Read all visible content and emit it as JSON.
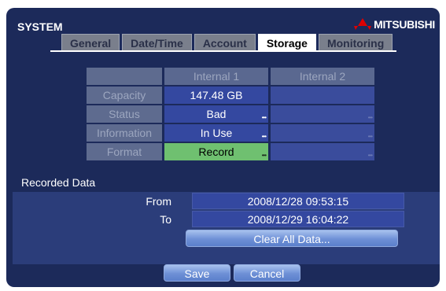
{
  "window": {
    "title": "SYSTEM",
    "brand": "MITSUBISHI"
  },
  "tabs": [
    {
      "label": "General",
      "active": false
    },
    {
      "label": "Date/Time",
      "active": false
    },
    {
      "label": "Account",
      "active": false
    },
    {
      "label": "Storage",
      "active": true
    },
    {
      "label": "Monitoring",
      "active": false
    }
  ],
  "storage": {
    "columns": [
      "Internal 1",
      "Internal 2"
    ],
    "rows": [
      {
        "label": "Capacity",
        "internal1": "147.48 GB",
        "internal2": ""
      },
      {
        "label": "Status",
        "internal1": "Bad",
        "internal2": ""
      },
      {
        "label": "Information",
        "internal1": "In Use",
        "internal2": ""
      },
      {
        "label": "Format",
        "internal1": "Record",
        "internal2": ""
      }
    ]
  },
  "recorded_data": {
    "title": "Recorded Data",
    "from_label": "From",
    "from_value": "2008/12/28  09:53:15",
    "to_label": "To",
    "to_value": "2008/12/29  16:04:22",
    "clear_label": "Clear All Data..."
  },
  "buttons": {
    "save": "Save",
    "cancel": "Cancel"
  },
  "colors": {
    "background": "#1c2a5a",
    "active_tab": "#ffffff",
    "record_highlight": "#6fc070",
    "value_cell": "#3448a0"
  }
}
